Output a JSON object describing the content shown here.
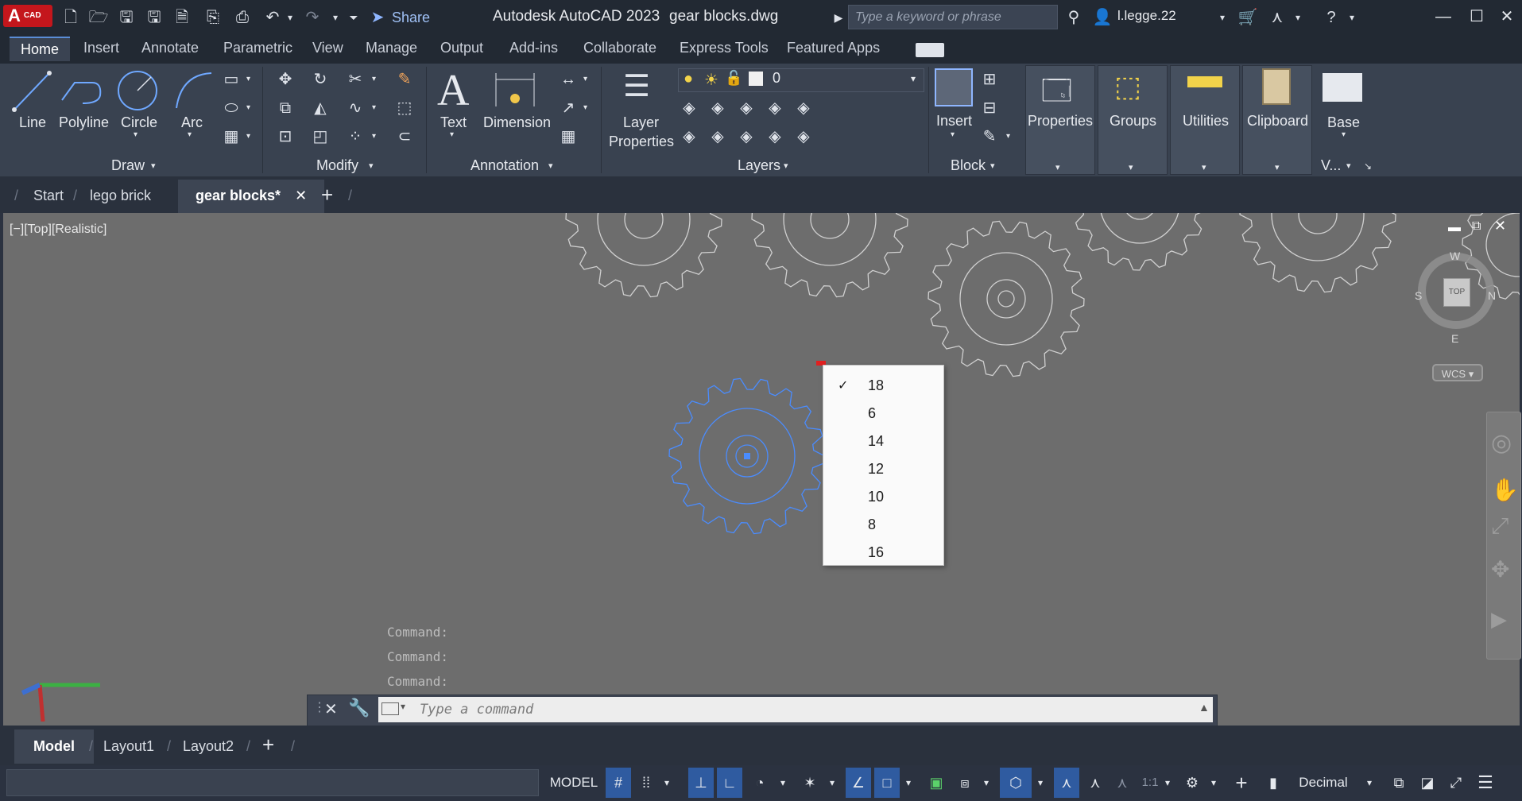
{
  "app": {
    "logo_text": "A",
    "logo_sub": "CAD",
    "share_label": "Share",
    "title": "Autodesk AutoCAD 2023",
    "document": "gear blocks.dwg",
    "search_placeholder": "Type a keyword or phrase",
    "user": "l.legge.22"
  },
  "menu_tabs": [
    "Home",
    "Insert",
    "Annotate",
    "Parametric",
    "View",
    "Manage",
    "Output",
    "Add-ins",
    "Collaborate",
    "Express Tools",
    "Featured Apps"
  ],
  "ribbon": {
    "draw": {
      "line": "Line",
      "polyline": "Polyline",
      "circle": "Circle",
      "arc": "Arc",
      "title": "Draw"
    },
    "modify": {
      "title": "Modify"
    },
    "annotation": {
      "text": "Text",
      "dimension": "Dimension",
      "title": "Annotation"
    },
    "layers": {
      "layer_props_1": "Layer",
      "layer_props_2": "Properties",
      "current_layer": "0",
      "title": "Layers"
    },
    "block": {
      "insert": "Insert",
      "title": "Block"
    },
    "properties": "Properties",
    "groups": "Groups",
    "utilities": "Utilities",
    "clipboard": "Clipboard",
    "base": "Base",
    "view_short": "V..."
  },
  "file_tabs": [
    "Start",
    "lego brick",
    "gear blocks*"
  ],
  "viewport": {
    "label": "[−][Top][Realistic]",
    "viewcube_face": "TOP",
    "compass": {
      "n": "N",
      "s": "S",
      "e": "E",
      "w": "W"
    },
    "wcs": "WCS"
  },
  "dropdown": {
    "selected": "18",
    "items": [
      "18",
      "6",
      "14",
      "12",
      "10",
      "8",
      "16"
    ]
  },
  "command": {
    "history": [
      "Command:",
      "Command:",
      "Command:"
    ],
    "placeholder": "Type a command"
  },
  "layout_tabs": [
    "Model",
    "Layout1",
    "Layout2"
  ],
  "status": {
    "model": "MODEL",
    "scale": "1:1",
    "units": "Decimal"
  },
  "colors": {
    "accent_blue": "#4a8cff",
    "viewport_bg": "#6d6d6d",
    "gear_line": "#d0d0d0",
    "logo_red": "#c4161c"
  }
}
